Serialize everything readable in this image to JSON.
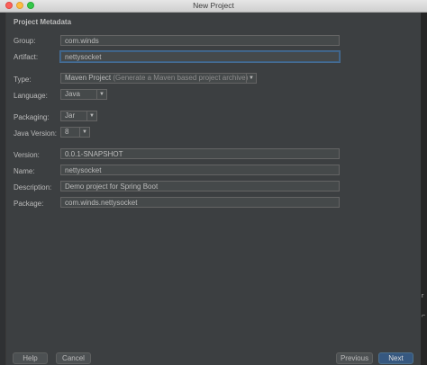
{
  "window": {
    "title": "New Project"
  },
  "section": {
    "title": "Project Metadata"
  },
  "fields": {
    "group": {
      "label": "Group:",
      "value": "com.winds"
    },
    "artifact": {
      "label": "Artifact:",
      "value": "nettysocket"
    },
    "type": {
      "label": "Type:",
      "value": "Maven Project",
      "hint": "(Generate a Maven based project archive)"
    },
    "language": {
      "label": "Language:",
      "value": "Java"
    },
    "packaging": {
      "label": "Packaging:",
      "value": "Jar"
    },
    "java_version": {
      "label": "Java Version:",
      "value": "8"
    },
    "version": {
      "label": "Version:",
      "value": "0.0.1-SNAPSHOT"
    },
    "name": {
      "label": "Name:",
      "value": "nettysocket"
    },
    "description": {
      "label": "Description:",
      "value": "Demo project for Spring Boot"
    },
    "package": {
      "label": "Package:",
      "value": "com.winds.nettysocket"
    }
  },
  "buttons": {
    "help": "Help",
    "cancel": "Cancel",
    "previous": "Previous",
    "next": "Next"
  },
  "colors": {
    "dialog_bg": "#3c3f41",
    "field_bg": "#45494a",
    "focus_border": "#3d6185",
    "primary_button": "#365880"
  }
}
